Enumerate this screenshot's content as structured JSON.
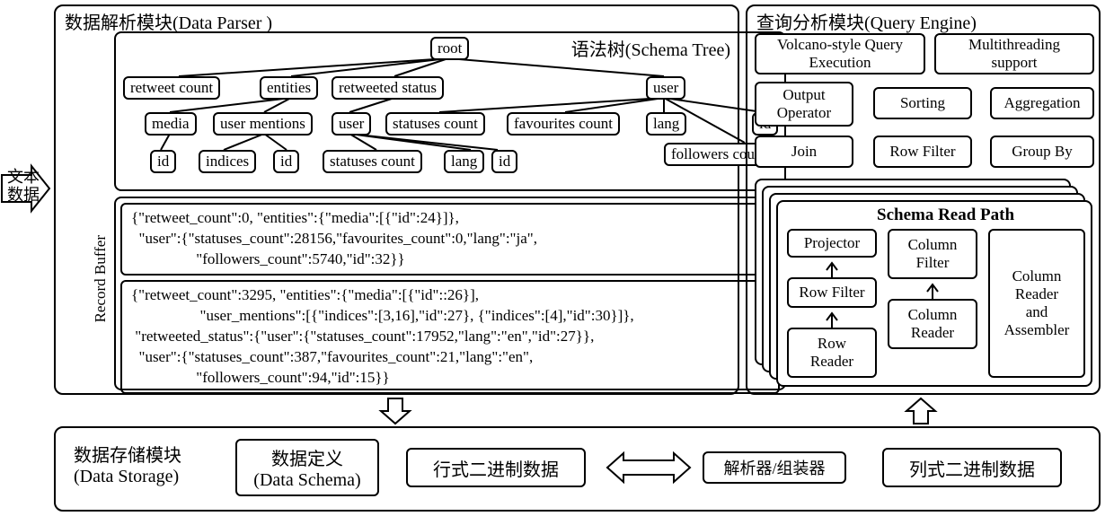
{
  "parser": {
    "title": "数据解析模块(Data Parser )",
    "tree_title": "语法树(Schema Tree)",
    "buffer_label": "Record Buffer",
    "nodes": {
      "root": "root",
      "retweet_count": "retweet count",
      "entities": "entities",
      "retweeted_status": "retweeted status",
      "user": "user",
      "media": "media",
      "user_mentions": "user mentions",
      "user2": "user",
      "statuses_count": "statuses count",
      "favourites_count": "favourites count",
      "lang": "lang",
      "id_u": "id",
      "followers_count": "followers count",
      "id1": "id",
      "indices": "indices",
      "id2": "id",
      "statuses_count2": "statuses count",
      "lang2": "lang",
      "id3": "id"
    },
    "json1": "{\"retweet_count\":0, \"entities\":{\"media\":[{\"id\":24}]},\n  \"user\":{\"statuses_count\":28156,\"favourites_count\":0,\"lang\":\"ja\",\n                 \"followers_count\":5740,\"id\":32}}",
    "json2": "{\"retweet_count\":3295, \"entities\":{\"media\":[{\"id\"::26}],\n                  \"user_mentions\":[{\"indices\":[3,16],\"id\":27}, {\"indices\":[4],\"id\":30}]},\n \"retweeted_status\":{\"user\":{\"statuses_count\":17952,\"lang\":\"en\",\"id\":27}},\n  \"user\":{\"statuses_count\":387,\"favourites_count\":21,\"lang\":\"en\",\n                 \"followers_count\":94,\"id\":15}}"
  },
  "query": {
    "title": "查询分析模块(Query Engine)",
    "volcano": "Volcano-style Query\nExecution",
    "multithreading": "Multithreading\nsupport",
    "output_operator": "Output\nOperator",
    "sorting": "Sorting",
    "aggregation": "Aggregation",
    "join": "Join",
    "row_filter": "Row Filter",
    "group_by": "Group By",
    "schema_read_path": "Schema Read Path",
    "projector": "Projector",
    "row_filter2": "Row Filter",
    "row_reader": "Row\nReader",
    "column_filter": "Column\nFilter",
    "column_reader": "Column\nReader",
    "column_reader_assembler": "Column\nReader\nand\nAssembler"
  },
  "storage": {
    "title_cn": "数据存储模块",
    "title_en": "(Data Storage)",
    "schema_cn": "数据定义",
    "schema_en": "(Data Schema)",
    "row_binary": "行式二进制数据",
    "parser_assembler": "解析器/组装器",
    "col_binary": "列式二进制数据"
  },
  "input_label": "文本\n数据"
}
